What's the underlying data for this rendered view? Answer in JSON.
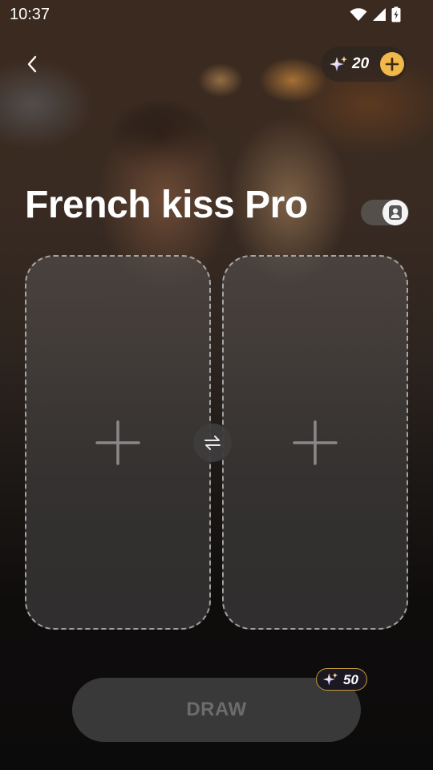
{
  "status_bar": {
    "time": "10:37",
    "icons": [
      "wifi-icon",
      "signal-icon",
      "battery-charging-icon"
    ]
  },
  "header": {
    "back_icon": "chevron-left-icon",
    "credits": {
      "icon": "sparkle-star-icon",
      "count": "20",
      "add_icon": "plus-icon"
    }
  },
  "main": {
    "title": "French kiss Pro",
    "profile_toggle_icon": "person-badge-icon",
    "upload_slots": [
      {
        "icon": "plus-icon"
      },
      {
        "icon": "plus-icon"
      }
    ],
    "swap_icon": "swap-arrows-icon"
  },
  "footer": {
    "draw_label": "DRAW",
    "cost": {
      "icon": "sparkle-star-icon",
      "count": "50"
    }
  },
  "colors": {
    "accent_gold": "#f1b84a",
    "button_disabled": "#3a3939",
    "button_text_disabled": "#6d6b6b",
    "background": "#0f0d0c"
  }
}
